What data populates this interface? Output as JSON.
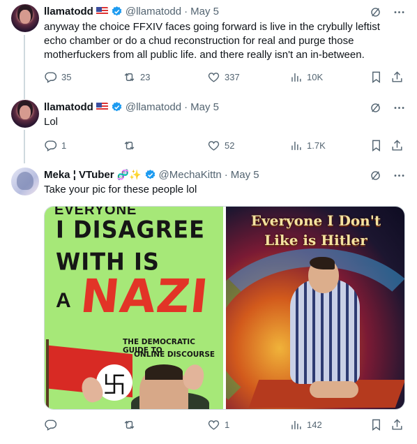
{
  "colors": {
    "text": "#0f1419",
    "muted": "#536471",
    "verified": "#1d9bf0",
    "divider": "#cfd9de"
  },
  "tweets": [
    {
      "name": "llamatodd",
      "flag": "US flag",
      "handle": "@llamatodd",
      "dot": "·",
      "date": "May 5",
      "text": "anyway the choice FFXIV faces going forward is live in the crybully leftist echo chamber or do a chud reconstruction for real and purge those motherfuckers from all public life. and there really isn't an in-between.",
      "replies": "35",
      "retweets": "23",
      "likes": "337",
      "views": "10K"
    },
    {
      "name": "llamatodd",
      "flag": "US flag",
      "handle": "@llamatodd",
      "dot": "·",
      "date": "May 5",
      "text": "Lol",
      "replies": "1",
      "retweets": "",
      "likes": "52",
      "views": "1.7K"
    },
    {
      "name": "Meka ¦ VTuber",
      "emojis": "🧬✨",
      "handle": "@MechaKittn",
      "dot": "·",
      "date": "May 5",
      "text": "Take your pic for these people lol",
      "replies": "",
      "retweets": "",
      "likes": "1",
      "views": "142",
      "media": {
        "left": {
          "top_line": "EVERYONE",
          "line1": "I DISAGREE",
          "line2": "WITH IS",
          "line3": "A",
          "big": "NAZI",
          "sub1": "THE DEMOCRATIC GUIDE TO",
          "sub2": "ONLINE DISCOURSE",
          "swastika": "卐"
        },
        "right": {
          "title1": "Everyone I Don't",
          "title2": "Like is Hitler"
        }
      }
    }
  ],
  "icons": {
    "grok": "grok-icon",
    "more": "more-icon",
    "reply": "reply-icon",
    "retweet": "retweet-icon",
    "like": "like-icon",
    "views": "views-icon",
    "bookmark": "bookmark-icon",
    "share": "share-icon"
  }
}
